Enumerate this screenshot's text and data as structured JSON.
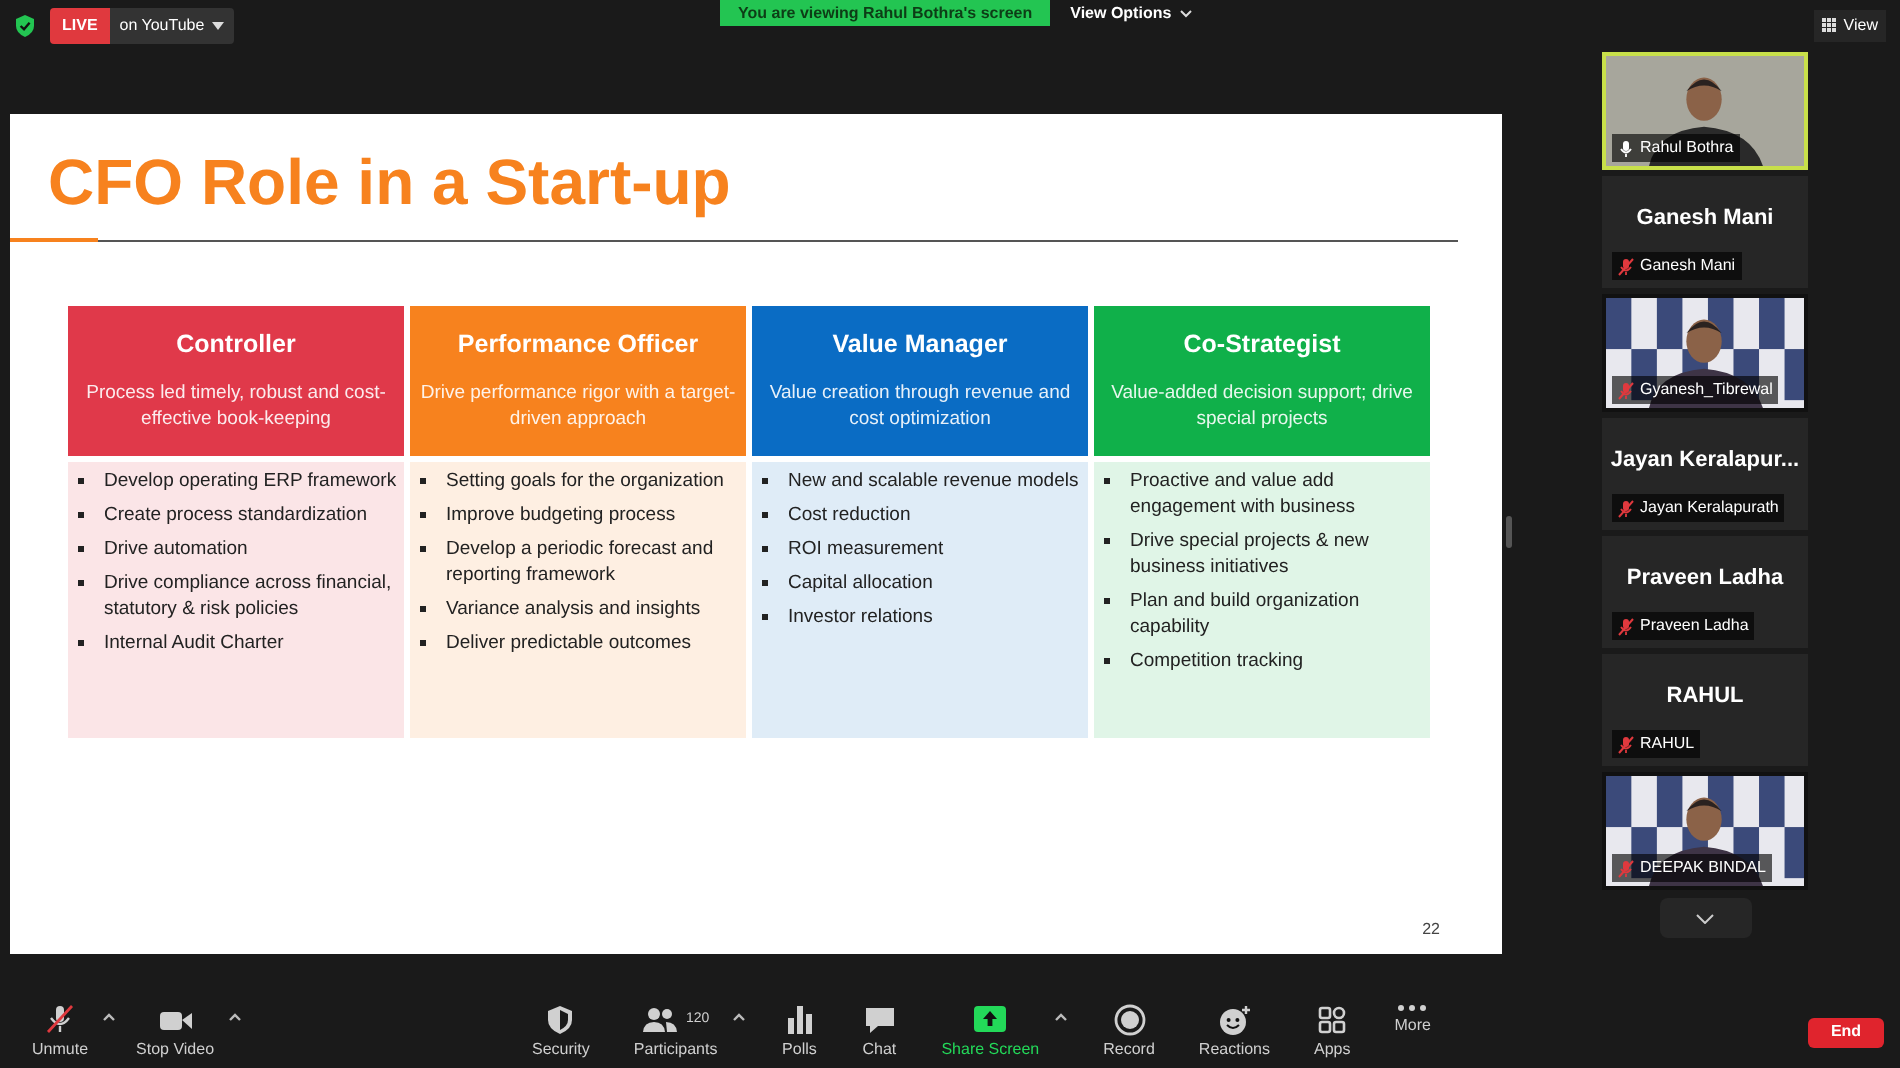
{
  "top_bar": {
    "live_badge": "LIVE",
    "stream_menu": "on YouTube",
    "banner": "You are viewing Rahul Bothra's screen",
    "view_options": "View Options",
    "view_button": "View"
  },
  "slide": {
    "title": "CFO Role in a Start-up",
    "page_number": "22",
    "columns": [
      {
        "heading": "Controller",
        "subtitle": "Process led timely, robust and cost-effective book-keeping",
        "color": "#e0394a",
        "bullets": [
          "Develop operating ERP framework",
          "Create process standardization",
          "Drive automation",
          "Drive compliance across financial, statutory & risk policies",
          "Internal Audit Charter"
        ]
      },
      {
        "heading": "Performance Officer",
        "subtitle": "Drive performance rigor with a target-driven approach",
        "color": "#f7821e",
        "bullets": [
          "Setting goals for the organization",
          "Improve budgeting process",
          "Develop a periodic forecast and reporting framework",
          "Variance analysis and insights",
          "Deliver predictable outcomes"
        ]
      },
      {
        "heading": "Value Manager",
        "subtitle": "Value creation through revenue and cost optimization",
        "color": "#0a6cc4",
        "bullets": [
          "New and scalable revenue models",
          "Cost reduction",
          "ROI measurement",
          "Capital allocation",
          "Investor relations"
        ]
      },
      {
        "heading": "Co-Strategist",
        "subtitle": "Value-added decision support; drive special projects",
        "color": "#10b04a",
        "bullets": [
          "Proactive and value add engagement with business",
          "Drive special projects & new business initiatives",
          "Plan and build organization capability",
          "Competition tracking"
        ]
      }
    ]
  },
  "participants": [
    {
      "kind": "video",
      "label": "Rahul Bothra",
      "active": true,
      "muted": false
    },
    {
      "kind": "name",
      "title": "Ganesh Mani",
      "label": "Ganesh Mani",
      "active": false,
      "muted": true
    },
    {
      "kind": "video",
      "label": "Gyanesh_Tibrewal",
      "active": false,
      "muted": true
    },
    {
      "kind": "name",
      "title": "Jayan  Keralapur...",
      "label": "Jayan Keralapurath",
      "active": false,
      "muted": true
    },
    {
      "kind": "name",
      "title": "Praveen Ladha",
      "label": "Praveen Ladha",
      "active": false,
      "muted": true
    },
    {
      "kind": "name",
      "title": "RAHUL",
      "label": "RAHUL",
      "active": false,
      "muted": true
    },
    {
      "kind": "video",
      "label": "DEEPAK BINDAL",
      "active": false,
      "muted": true
    }
  ],
  "toolbar": [
    {
      "kind": "mic",
      "label": "Unmute",
      "caret": true,
      "highlighted": false
    },
    {
      "kind": "camera",
      "label": "Stop Video",
      "caret": true,
      "highlighted": false
    },
    {
      "kind": "shield",
      "label": "Security",
      "caret": false,
      "highlighted": false
    },
    {
      "kind": "people",
      "label": "Participants",
      "count": "120",
      "caret": true,
      "highlighted": false
    },
    {
      "kind": "bars",
      "label": "Polls",
      "caret": false,
      "highlighted": false
    },
    {
      "kind": "chat",
      "label": "Chat",
      "caret": false,
      "highlighted": false
    },
    {
      "kind": "share",
      "label": "Share Screen",
      "caret": true,
      "highlighted": true
    },
    {
      "kind": "record",
      "label": "Record",
      "caret": false,
      "highlighted": false
    },
    {
      "kind": "smile",
      "label": "Reactions",
      "caret": false,
      "highlighted": false
    },
    {
      "kind": "apps",
      "label": "Apps",
      "caret": false,
      "highlighted": false
    },
    {
      "kind": "dots",
      "label": "More",
      "caret": false,
      "highlighted": false
    }
  ],
  "end_button": "End"
}
